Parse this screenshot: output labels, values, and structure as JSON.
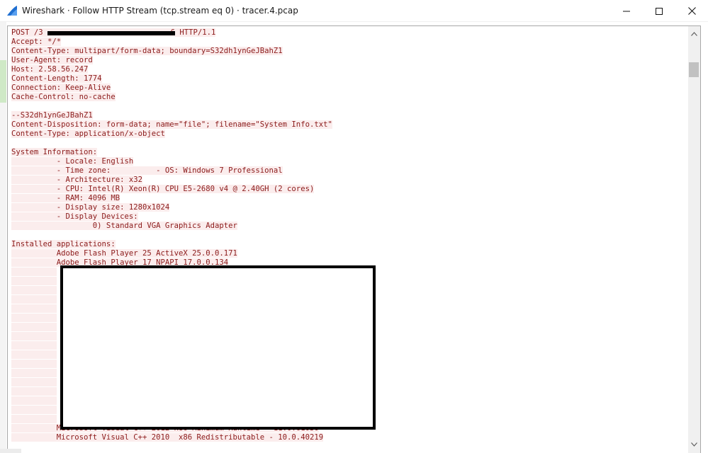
{
  "window": {
    "title": "Wireshark · Follow HTTP Stream (tcp.stream eq 0) · tracer.4.pcap",
    "icon": "wireshark-fin-icon",
    "minimize_icon": "minimize-icon",
    "maximize_icon": "maximize-icon",
    "close_icon": "close-icon"
  },
  "colors": {
    "client_text": "#8b1a1a",
    "client_bg": "#fbeded",
    "redaction": "#000000"
  },
  "stream": {
    "request_line_prefix": "POST /3",
    "request_line_suffix": "6 HTTP/1.1",
    "headers": [
      "Accept: */*",
      "Content-Type: multipart/form-data; boundary=S32dh1ynGeJBahZ1",
      "User-Agent: record",
      "Host: 2.58.56.247",
      "Content-Length: 1774",
      "Connection: Keep-Alive",
      "Cache-Control: no-cache"
    ],
    "boundary_line": "--S32dh1ynGeJBahZ1",
    "part_headers": [
      "Content-Disposition: form-data; name=\"file\"; filename=\"System Info.txt\"",
      "Content-Type: application/x-object"
    ],
    "system_info_heading": "System Information:",
    "system_info": [
      "          - Locale: English",
      "          - Time zone:          - OS: Windows 7 Professional",
      "          - Architecture: x32",
      "          - CPU: Intel(R) Xeon(R) CPU E5-2680 v4 @ 2.40GH (2 cores)",
      "          - RAM: 4096 MB",
      "          - Display size: 1280x1024",
      "          - Display Devices:",
      "                  0) Standard VGA Graphics Adapter"
    ],
    "installed_heading": "Installed applications:",
    "installed": [
      "          Adobe Flash Player 25 ActiveX 25.0.0.171",
      "          Adobe Flash Player 17 NPAPI 17.0.0.134",
      "          Microsoft Visual C++ 2012 x86 Minimum Runtime - 11.0.61030",
      "          Microsoft Visual C++ 2010  x86 Redistributable - 10.0.40219"
    ]
  }
}
